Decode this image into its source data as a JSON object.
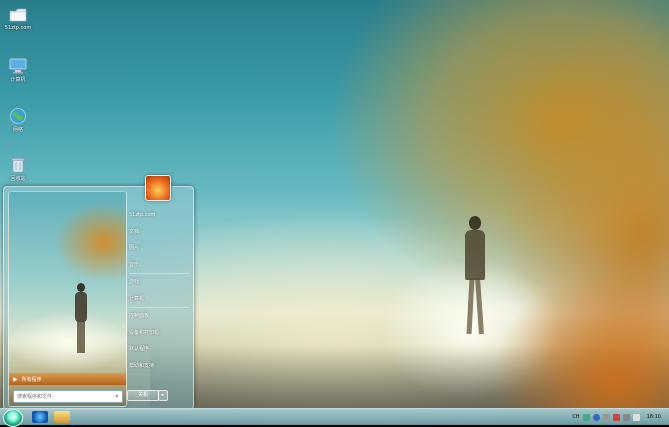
{
  "desktop": {
    "icons": [
      {
        "label": "51ztp.com",
        "icon": "folder-icon"
      },
      {
        "label": "计算机",
        "icon": "computer-icon"
      },
      {
        "label": "网络",
        "icon": "network-icon"
      },
      {
        "label": "回收站",
        "icon": "recycle-bin-icon"
      }
    ]
  },
  "start_menu": {
    "all_programs": "所有程序",
    "search_placeholder": "搜索程序和文件",
    "right_items": [
      "51ztp.com",
      "文档",
      "图片",
      "音乐",
      "游戏",
      "计算机",
      "控制面板",
      "设备和打印机",
      "默认程序",
      "帮助和支持"
    ],
    "shutdown_label": "关机"
  },
  "taskbar": {
    "clock": "18:10",
    "tray_lang": "CH"
  },
  "colors": {
    "accent_orange": "#c8741e",
    "sky_teal": "#3a9aa8"
  }
}
